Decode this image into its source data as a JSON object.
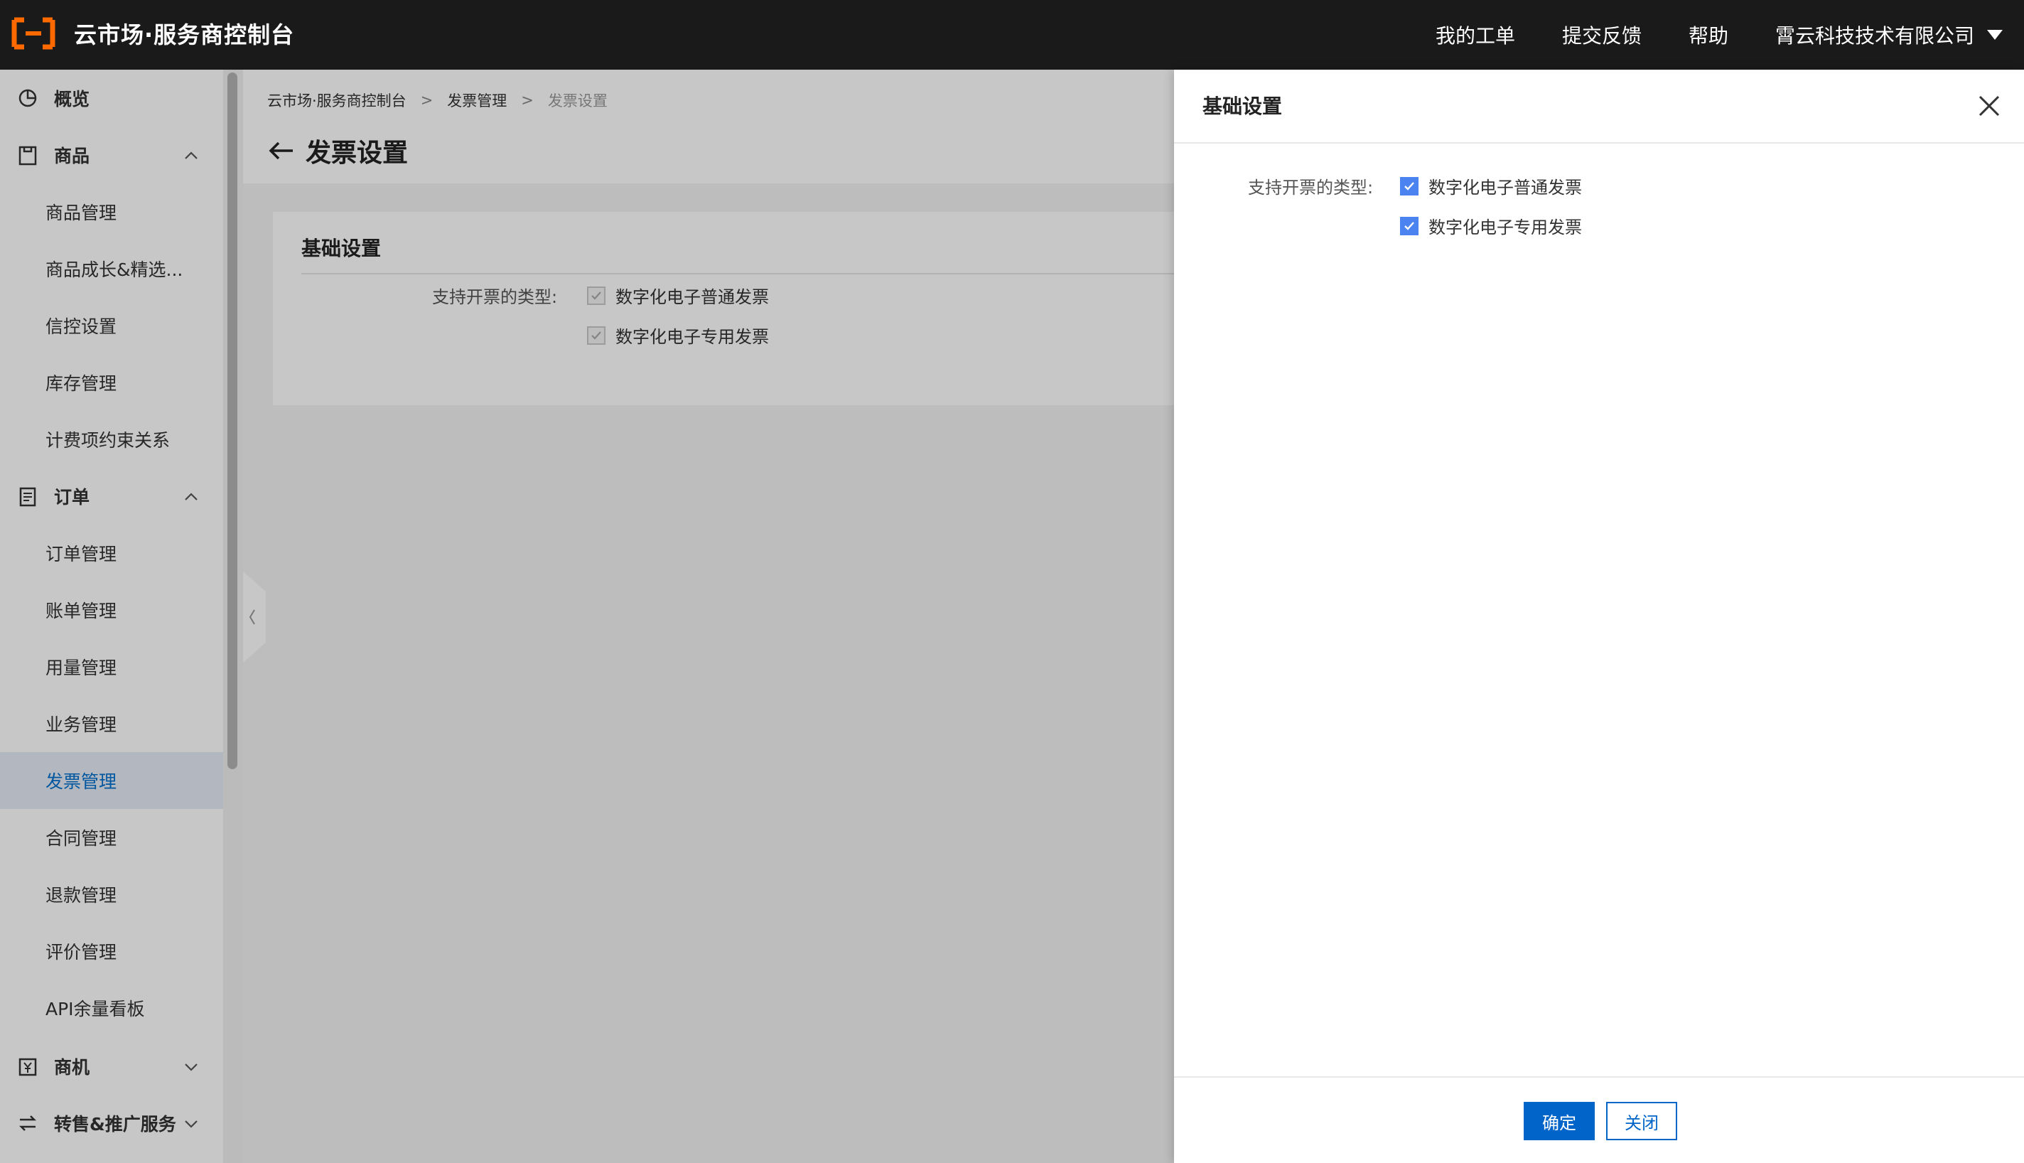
{
  "topbar": {
    "app_title": "云市场·服务商控制台",
    "nav": [
      "我的工单",
      "提交反馈",
      "帮助"
    ],
    "company": "霄云科技技术有限公司"
  },
  "sidebar": {
    "overview": "概览",
    "goods": {
      "label": "商品",
      "items": [
        "商品管理",
        "商品成长&精选...",
        "信控设置",
        "库存管理",
        "计费项约束关系"
      ]
    },
    "orders": {
      "label": "订单",
      "items": [
        "订单管理",
        "账单管理",
        "用量管理",
        "业务管理",
        "发票管理",
        "合同管理",
        "退款管理",
        "评价管理",
        "API余量看板"
      ],
      "active": "发票管理"
    },
    "opportunity": "商机",
    "resale": "转售&推广服务"
  },
  "main": {
    "breadcrumb": [
      "云市场·服务商控制台",
      "发票管理",
      "发票设置"
    ],
    "page_title": "发票设置",
    "card": {
      "title": "基础设置",
      "label": "支持开票的类型:",
      "options": [
        "数字化电子普通发票",
        "数字化电子专用发票"
      ]
    }
  },
  "drawer": {
    "title": "基础设置",
    "label": "支持开票的类型:",
    "options": [
      {
        "label": "数字化电子普通发票",
        "checked": true
      },
      {
        "label": "数字化电子专用发票",
        "checked": true
      }
    ],
    "confirm": "确定",
    "close": "关闭"
  },
  "colors": {
    "accent": "#0064c8",
    "checkbox": "#4b83f0",
    "logo": "#ff6a00",
    "active_bg": "#e6ebf5"
  }
}
